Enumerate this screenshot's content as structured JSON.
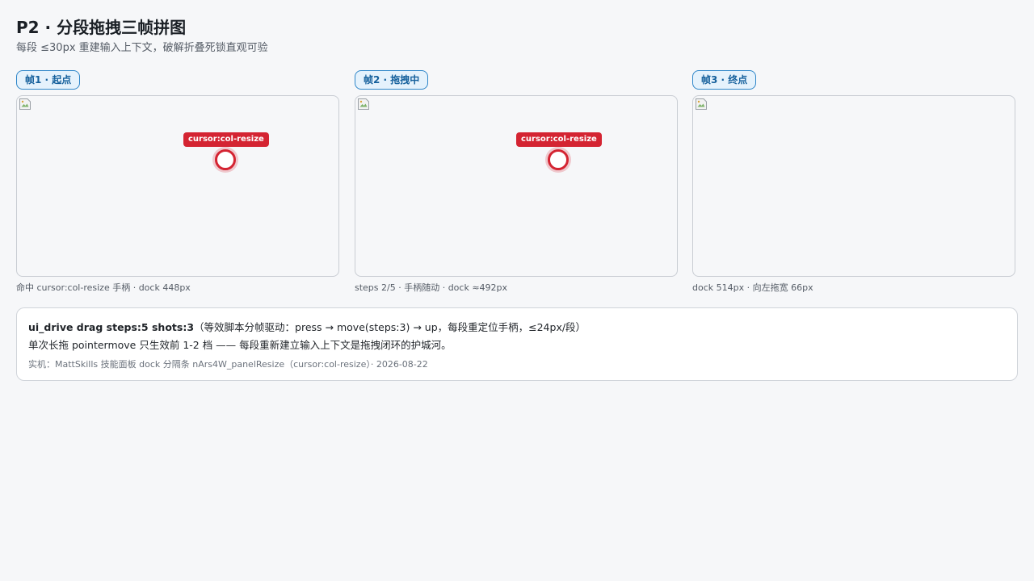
{
  "page": {
    "title": "P2 · 分段拖拽三帧拼图",
    "subtitle": "每段 ≤30px 重建输入上下文，破解折叠死锁直观可验"
  },
  "frames": [
    {
      "badge": "帧1 · 起点",
      "cursor_label": "cursor:col-resize",
      "caption": "命中 cursor:col-resize 手柄 · dock 448px",
      "image_icon": "broken-image-icon"
    },
    {
      "badge": "帧2 · 拖拽中",
      "cursor_label": "cursor:col-resize",
      "caption": "steps 2/5 · 手柄随动 · dock ≈492px",
      "image_icon": "broken-image-icon"
    },
    {
      "badge": "帧3 · 终点",
      "caption": "dock 514px · 向左拖宽 66px",
      "image_icon": "broken-image-icon"
    }
  ],
  "info": {
    "command": "ui_drive drag steps:5 shots:3",
    "command_note": "（等效脚本分帧驱动：press → move(steps:3) → up，每段重定位手柄，≤24px/段）",
    "line2": "单次长拖 pointermove 只生效前 1-2 档 —— 每段重新建立输入上下文是拖拽闭环的护城河。",
    "line3": "实机：MattSkills 技能面板 dock 分隔条 nArs4W_panelResize（cursor:col-resize）· 2026-08-22"
  },
  "colors": {
    "accent": "#2e86c9",
    "cursor_marker": "#d42432",
    "background": "#f6f7f9"
  }
}
